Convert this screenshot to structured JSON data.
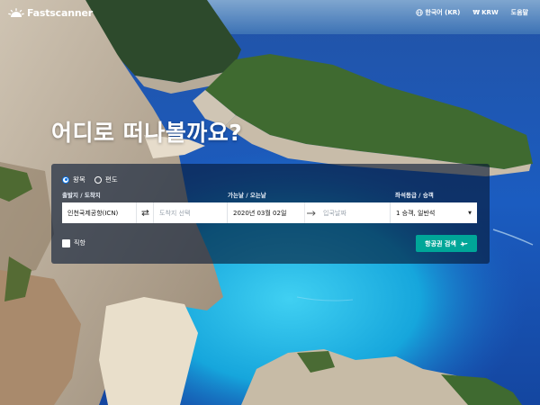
{
  "brand": {
    "name": "Fastscanner"
  },
  "nav": {
    "language": "한국어 (KR)",
    "currency": "KRW",
    "help": "도움말"
  },
  "hero": {
    "headline": "어디로 떠나볼까요?"
  },
  "search": {
    "trip_types": [
      {
        "label": "왕복",
        "selected": true
      },
      {
        "label": "편도",
        "selected": false
      }
    ],
    "labels": {
      "route": "출발지 / 도착지",
      "dates": "가는날 / 오는날",
      "cabin": "좌석등급 / 승객"
    },
    "origin": "인천국제공항(ICN)",
    "destination_placeholder": "도착지 선택",
    "depart_date": "2020년 03월 02일",
    "return_placeholder": "입국날짜",
    "cabin_passengers": "1 승객, 일반석",
    "direct_only": {
      "label": "직항",
      "checked": false
    },
    "submit_label": "항공권 검색"
  },
  "colors": {
    "panel": "#071834",
    "accent_radio": "#0770e3",
    "search_button": "#00a698",
    "sea_deep": "#1450a8",
    "sea_light": "#29b6e6"
  }
}
